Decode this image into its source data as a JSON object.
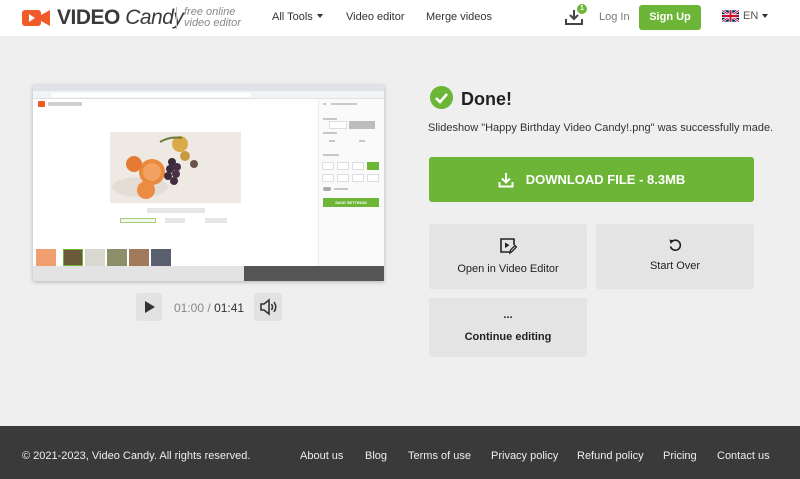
{
  "header": {
    "logo_text": "VIDEO",
    "logo_text_italic": "Candy",
    "tagline_line1": "free online",
    "tagline_line2": "video editor",
    "nav": {
      "all_tools": "All Tools",
      "video_editor": "Video editor",
      "merge_videos": "Merge videos"
    },
    "downloads_count": "1",
    "login": "Log In",
    "signup": "Sign Up",
    "language": "EN"
  },
  "preview": {
    "save_settings": "SAVE SETTINGS",
    "progress_played_fraction": 0.6
  },
  "player": {
    "current_time": "01:00",
    "separator": "/",
    "duration": "01:41"
  },
  "result": {
    "title": "Done!",
    "message": "Slideshow \"Happy Birthday Video Candy!.png\" was successfully made.",
    "download_label": "DOWNLOAD FILE - 8.3MB",
    "open_editor_label": "Open in Video Editor",
    "start_over_label": "Start Over",
    "continue_dots": "...",
    "continue_label": "Continue editing"
  },
  "footer": {
    "copyright": "© 2021-2023, Video Candy. All rights reserved.",
    "links": [
      "About us",
      "Blog",
      "Terms of use",
      "Privacy policy",
      "Refund policy",
      "Pricing",
      "Contact us"
    ]
  },
  "colors": {
    "brand_green": "#6cb536",
    "brand_orange": "#f15a29",
    "footer_bg": "#3a3a3a"
  },
  "icons": {
    "logo": "camera-icon",
    "downloads": "download-tray-icon",
    "done": "check-circle-icon",
    "download": "download-icon",
    "open_editor": "video-edit-icon",
    "start_over": "restart-icon",
    "play": "play-icon",
    "volume": "volume-icon",
    "language": "uk-flag-icon"
  }
}
